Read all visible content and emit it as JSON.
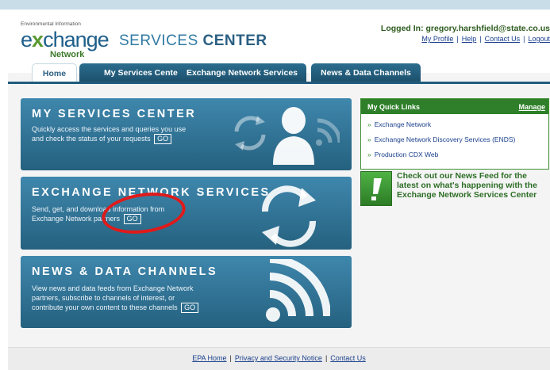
{
  "logo": {
    "small_text": "Environmental Information",
    "ex": "e",
    "change": "change",
    "network": "Network"
  },
  "header": {
    "title_light": "SERVICES",
    "title_bold": "CENTER"
  },
  "user": {
    "logged_in": "Logged In: gregory.harshfield@state.co.us",
    "links": [
      "My Profile",
      "Help",
      "Contact Us",
      "Logout"
    ]
  },
  "tabs": [
    "Home",
    "My Services Center",
    "Exchange Network Services",
    "News & Data Channels"
  ],
  "panels": [
    {
      "title": "MY SERVICES CENTER",
      "desc_lines": [
        "Quickly access the services and queries you use",
        "and check the status of your requests"
      ],
      "go": "GO"
    },
    {
      "title": "EXCHANGE NETWORK SERVICES",
      "desc_lines": [
        "Send, get, and download information from",
        "Exchange Network partners"
      ],
      "go": "GO"
    },
    {
      "title": "NEWS & DATA CHANNELS",
      "desc_lines": [
        "View news and data feeds from Exchange Network",
        "partners, subscribe to channels of interest, or",
        "contribute your own content to these channels"
      ],
      "go": "GO"
    }
  ],
  "quick_links": {
    "title": "My Quick Links",
    "manage": "Manage",
    "items": [
      "Exchange Network",
      "Exchange Network Discovery Services (ENDS)",
      "Production CDX Web"
    ]
  },
  "news_feed": {
    "text": "Check out our News Feed for the latest on what's happening with the Exchange Network Services Center"
  },
  "footer": {
    "links": [
      "EPA Home",
      "Privacy and Security Notice",
      "Contact Us"
    ]
  },
  "colors": {
    "panel": "#2f6f93",
    "tab": "#1f5c7c",
    "green": "#2f7f2a",
    "link": "#1a3f8c",
    "annotation": "#e01a1a"
  }
}
